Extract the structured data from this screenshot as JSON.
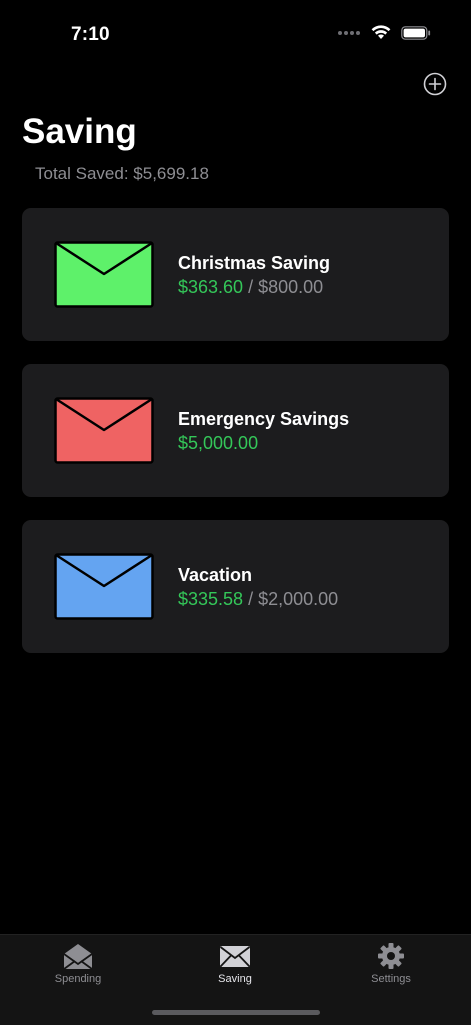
{
  "status_bar": {
    "time": "7:10"
  },
  "header": {
    "title": "Saving",
    "total_saved": "Total Saved: $5,699.18"
  },
  "envelopes": [
    {
      "name": "Christmas Saving",
      "saved": "$363.60",
      "separator": " / ",
      "goal": "$800.00",
      "color": "#5ef16a"
    },
    {
      "name": "Emergency Savings",
      "saved": "$5,000.00",
      "separator": "",
      "goal": "",
      "color": "#ef6363"
    },
    {
      "name": "Vacation",
      "saved": "$335.58",
      "separator": " / ",
      "goal": "$2,000.00",
      "color": "#64a4f1"
    }
  ],
  "tabs": [
    {
      "label": "Spending",
      "icon": "open-envelope-icon"
    },
    {
      "label": "Saving",
      "icon": "closed-envelope-icon"
    },
    {
      "label": "Settings",
      "icon": "gear-icon"
    }
  ],
  "colors": {
    "background": "#000000",
    "card": "#1c1c1e",
    "accent_green": "#34c759",
    "secondary_text": "#8e8e93"
  }
}
